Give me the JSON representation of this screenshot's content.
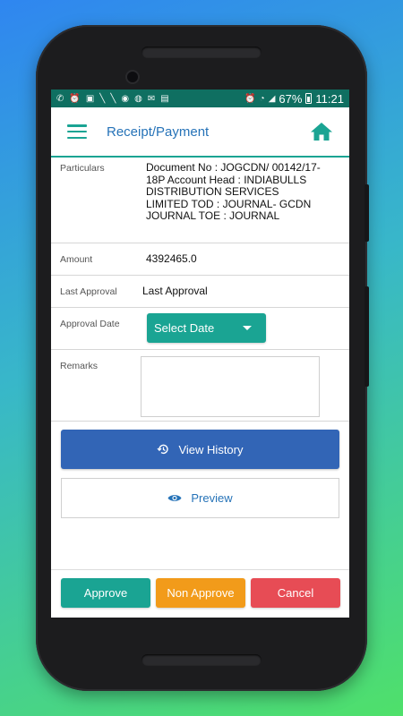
{
  "status_bar": {
    "battery": "67%",
    "time": "11:21",
    "icons": [
      "whatsapp-icon",
      "alarm-icon",
      "gallery-icon",
      "slash-icon",
      "slash-icon",
      "rupee-icon",
      "message-icon",
      "gmail-icon",
      "media-icon",
      "alarm-icon",
      "wifi-icon"
    ]
  },
  "app_bar": {
    "title": "Receipt/Payment"
  },
  "form": {
    "particulars_label": "Particulars",
    "particulars_value": "Document No : JOGCDN/ 00142/17-18P Account Head : INDIABULLS DISTRIBUTION SERVICES LIMITED TOD : JOURNAL- GCDN JOURNAL TOE : JOURNAL",
    "amount_label": "Amount",
    "amount_value": "4392465.0",
    "last_approval_label": "Last Approval",
    "last_approval_value": "Last Approval",
    "approval_date_label": "Approval Date",
    "select_date": "Select Date",
    "remarks_label": "Remarks",
    "remarks_value": ""
  },
  "actions": {
    "view_history": "View History",
    "preview": "Preview",
    "approve": "Approve",
    "non_approve": "Non Approve",
    "cancel": "Cancel"
  },
  "colors": {
    "accent": "#1aa493",
    "title": "#2673b8",
    "history_button": "#3265b6",
    "non_approve": "#f29b1a",
    "cancel": "#e74c55",
    "status_bar": "#0f6f61"
  }
}
